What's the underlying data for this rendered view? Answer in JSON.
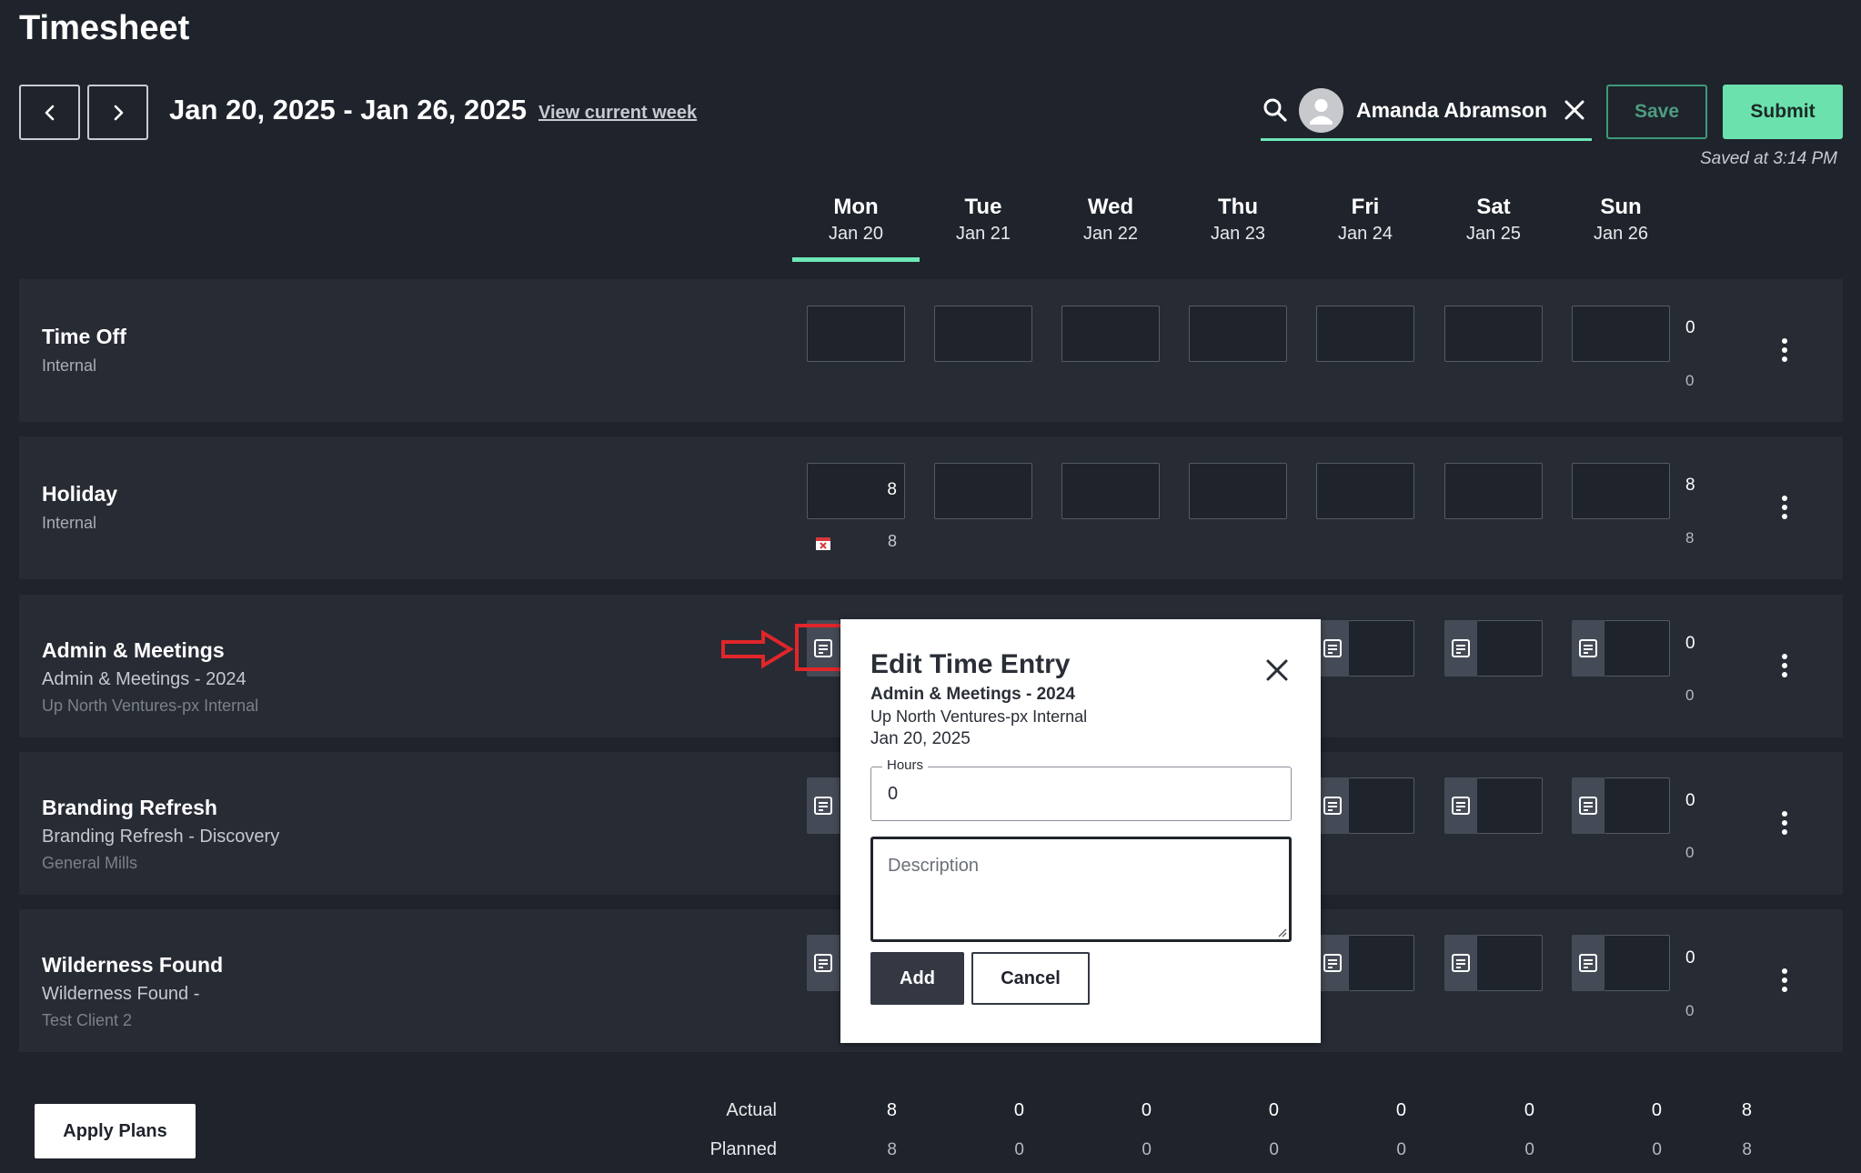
{
  "page": {
    "title": "Timesheet"
  },
  "week": {
    "range": "Jan 20, 2025 - Jan 26, 2025",
    "view_current": "View current week"
  },
  "user": {
    "name": "Amanda Abramson"
  },
  "actions": {
    "save": "Save",
    "submit": "Submit",
    "saved_at": "Saved at 3:14 PM",
    "apply_plans": "Apply Plans"
  },
  "days": [
    {
      "name": "Mon",
      "date": "Jan 20"
    },
    {
      "name": "Tue",
      "date": "Jan 21"
    },
    {
      "name": "Wed",
      "date": "Jan 22"
    },
    {
      "name": "Thu",
      "date": "Jan 23"
    },
    {
      "name": "Fri",
      "date": "Jan 24"
    },
    {
      "name": "Sat",
      "date": "Jan 25"
    },
    {
      "name": "Sun",
      "date": "Jan 26"
    }
  ],
  "rows": [
    {
      "title": "Time Off",
      "sub": "Internal",
      "client": "",
      "mon": "",
      "total": "0",
      "planned": "0"
    },
    {
      "title": "Holiday",
      "sub": "Internal",
      "client": "",
      "mon": "8",
      "mon_planned": "8",
      "total": "8",
      "planned": "8"
    },
    {
      "title": "Admin & Meetings",
      "sub": "Admin & Meetings - 2024",
      "client": "Up North Ventures-px Internal",
      "total": "0",
      "planned": "0"
    },
    {
      "title": "Branding Refresh",
      "sub": "Branding Refresh - Discovery",
      "client": "General Mills",
      "total": "0",
      "planned": "0"
    },
    {
      "title": "Wilderness Found",
      "sub": "Wilderness Found -",
      "client": "Test Client 2",
      "total": "0",
      "planned": "0"
    }
  ],
  "modal": {
    "title": "Edit Time Entry",
    "project": "Admin & Meetings - 2024",
    "client": "Up North Ventures-px Internal",
    "date": "Jan 20, 2025",
    "hours_label": "Hours",
    "hours_value": "0",
    "description_placeholder": "Description",
    "add": "Add",
    "cancel": "Cancel"
  },
  "summary": {
    "actual_label": "Actual",
    "planned_label": "Planned",
    "actual": [
      "8",
      "0",
      "0",
      "0",
      "0",
      "0",
      "0",
      "8"
    ],
    "planned": [
      "8",
      "0",
      "0",
      "0",
      "0",
      "0",
      "0",
      "8"
    ]
  },
  "colors": {
    "accent": "#6ee7b7",
    "background": "#1f232b",
    "row": "#272b34",
    "highlight": "#e0262a"
  }
}
